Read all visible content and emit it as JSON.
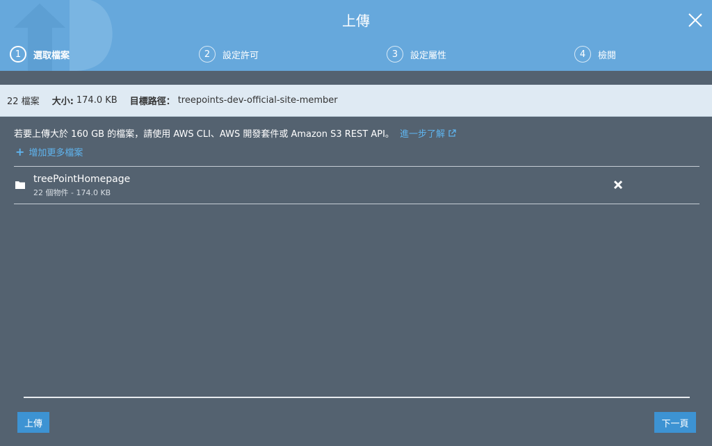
{
  "header": {
    "title": "上傳",
    "colors": {
      "background": "#66a8dc",
      "body": "#546270",
      "accent": "#5fb4ee",
      "button": "#3d93d3"
    },
    "steps": [
      {
        "number": "1",
        "label": "選取檔案",
        "active": true
      },
      {
        "number": "2",
        "label": "設定許可",
        "active": false
      },
      {
        "number": "3",
        "label": "設定屬性",
        "active": false
      },
      {
        "number": "4",
        "label": "檢閱",
        "active": false
      }
    ]
  },
  "summary": {
    "count": "22 檔案",
    "size_label": "大小:",
    "size_value": "174.0 KB",
    "target_label": "目標路徑：",
    "target_value": "treepoints-dev-official-site-member"
  },
  "notice": {
    "text": "若要上傳大於 160 GB 的檔案，請使用 AWS CLI、AWS 開發套件或 Amazon S3 REST API。",
    "link_label": "進一步了解"
  },
  "add_more_label": "增加更多檔案",
  "files": [
    {
      "name": "treePointHomepage",
      "meta": "22 個物件 - 174.0 KB",
      "icon": "folder-icon"
    }
  ],
  "footer": {
    "upload_label": "上傳",
    "next_label": "下一頁"
  }
}
